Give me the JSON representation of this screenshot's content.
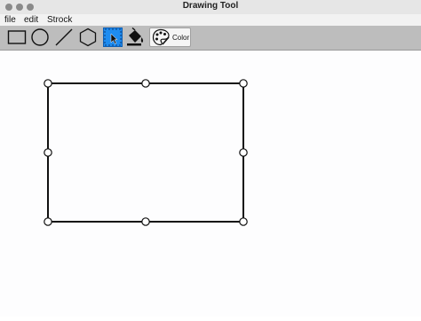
{
  "window": {
    "title": "Drawing Tool"
  },
  "menu": {
    "items": [
      "file",
      "edit",
      "Strock"
    ]
  },
  "toolbar": {
    "tools": [
      {
        "icon": "rectangle-icon"
      },
      {
        "icon": "circle-icon"
      },
      {
        "icon": "line-icon"
      },
      {
        "icon": "hexagon-icon"
      },
      {
        "icon": "select-arrow-icon",
        "selected": true
      },
      {
        "icon": "paint-bucket-icon"
      }
    ],
    "color_label": "Color",
    "selected_color": "#1e8cf0"
  },
  "canvas": {
    "shape": "rectangle",
    "selected": true,
    "stroke_color": "#111111"
  }
}
